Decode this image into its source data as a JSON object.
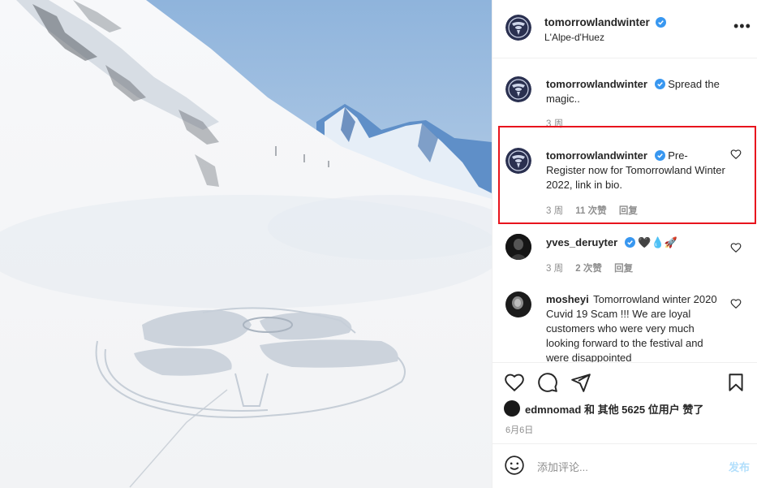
{
  "post": {
    "username": "tomorrowlandwinter",
    "location": "L'Alpe-d'Huez",
    "more_icon": "more-horizontal-icon"
  },
  "comments": [
    {
      "username": "tomorrowlandwinter",
      "text": "Spread the magic..",
      "time": "3 周",
      "likes": "",
      "reply": ""
    },
    {
      "username": "tomorrowlandwinter",
      "text": "Pre-Register now for Tomorrowland Winter 2022, link in bio.",
      "time": "3 周",
      "likes": "11 次赞",
      "reply": "回复"
    },
    {
      "username": "yves_deruyter",
      "text": "🖤💧🚀",
      "time": "3 周",
      "likes": "2 次赞",
      "reply": "回复"
    },
    {
      "username": "mosheyi",
      "text": "Tomorrowland winter 2020 Cuvid 19 Scam !!! We are loyal customers who were very much looking forward to the festival and were disappointed",
      "time": "",
      "likes": "",
      "reply": ""
    }
  ],
  "actions": {
    "liked_by": "edmnomad 和 其他 5625 位用户 赞了",
    "date": "6月6日"
  },
  "add_comment": {
    "placeholder": "添加评论...",
    "post_label": "发布"
  },
  "colors": {
    "verified": "#3897f0",
    "highlight": "#e8141d",
    "post_disabled": "#b2dffc"
  }
}
